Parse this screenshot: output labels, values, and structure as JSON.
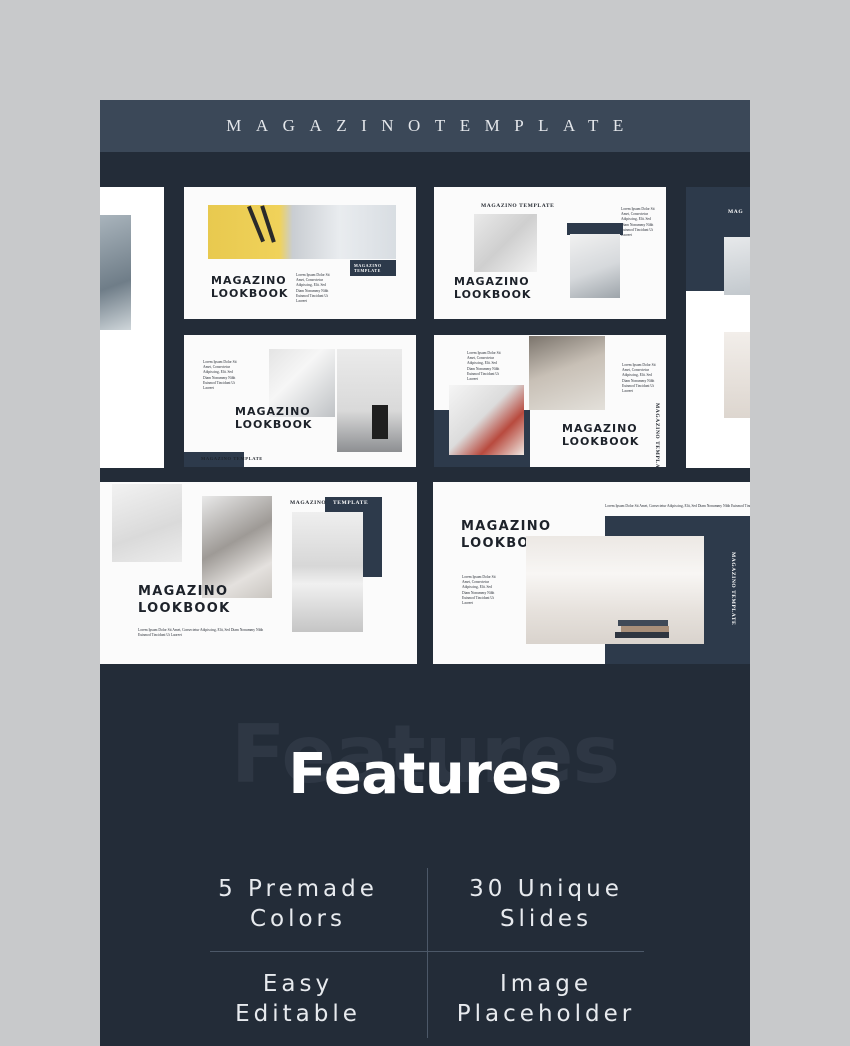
{
  "header": {
    "title": "MAGAZINOTEMPLATE"
  },
  "slides": {
    "heading": "MAGAZINO\nLOOKBOOK",
    "brand": "MAGAZINO TEMPLATE",
    "brand_split": [
      "MAGAZINO",
      "TEMPLATE"
    ],
    "brand_stack": "MAGAZINO\nTEMPLATE",
    "brand_short": "MAG",
    "body_text": "Lorem Ipsum Dolor Sit\nAmet, Consectetur\nAdipiscing, Elit. Sed\nDiam Nonummy Nibh\nEuismod Tincidunt Ut\nLaoreet",
    "body_wide": "Lorem Ipsum Dolor Sit Amet, Consectetur Adipiscing, Elit, Sed Diam Nonummy Nibh\nEuismod Tincidunt Ut Laoreet"
  },
  "features": {
    "title": "Features",
    "items": [
      {
        "label": "5 Premade\nColors"
      },
      {
        "label": "30 Unique\nSlides"
      },
      {
        "label": "Easy\nEditable"
      },
      {
        "label": "Image\nPlaceholder"
      }
    ]
  },
  "colors": {
    "page_bg": "#c8c9cb",
    "card_bg": "#232c38",
    "header_bg": "#3b4858",
    "accent_navy": "#2d3a4b",
    "text_light": "#e7eaee"
  }
}
